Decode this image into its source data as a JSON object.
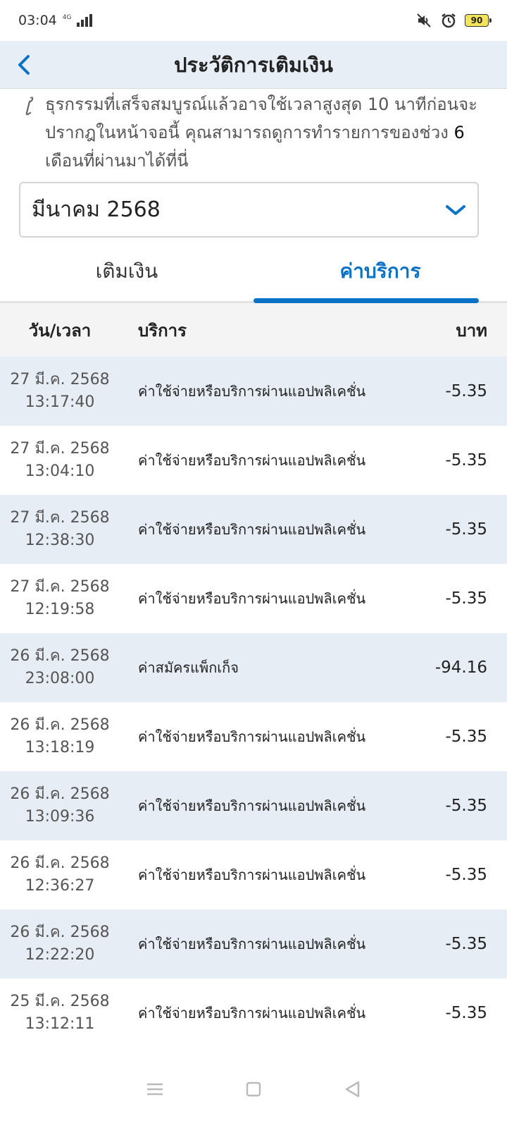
{
  "status_bar": {
    "time": "03:04",
    "network": "4G",
    "battery": "90"
  },
  "app_bar": {
    "title": "ประวัติการเติมเงิน"
  },
  "notice": {
    "text_a": "ธุรกรรมที่เสร็จสมบูรณ์แล้วอาจใช้เวลาสูงสุด 10 นาทีก่อนจะปรากฎในหน้าจอนี้ คุณสามารถดูการทำรายการของช่วง ",
    "highlight": "6",
    "text_b": " เดือนที่ผ่านมาได้ที่นี่"
  },
  "month_select": {
    "value": "มีนาคม 2568"
  },
  "tabs": [
    {
      "label": "เติมเงิน",
      "active": false
    },
    {
      "label": "ค่าบริการ",
      "active": true
    }
  ],
  "table": {
    "headers": {
      "date": "วัน/เวลา",
      "service": "บริการ",
      "amount": "บาท"
    },
    "rows": [
      {
        "date": "27 มี.ค. 2568",
        "time": "13:17:40",
        "service": "ค่าใช้จ่ายหรือบริการผ่านแอปพลิเคชั่น",
        "amount": "-5.35"
      },
      {
        "date": "27 มี.ค. 2568",
        "time": "13:04:10",
        "service": "ค่าใช้จ่ายหรือบริการผ่านแอปพลิเคชั่น",
        "amount": "-5.35"
      },
      {
        "date": "27 มี.ค. 2568",
        "time": "12:38:30",
        "service": "ค่าใช้จ่ายหรือบริการผ่านแอปพลิเคชั่น",
        "amount": "-5.35"
      },
      {
        "date": "27 มี.ค. 2568",
        "time": "12:19:58",
        "service": "ค่าใช้จ่ายหรือบริการผ่านแอปพลิเคชั่น",
        "amount": "-5.35"
      },
      {
        "date": "26 มี.ค. 2568",
        "time": "23:08:00",
        "service": "ค่าสมัครแพ็กเก็จ",
        "amount": "-94.16"
      },
      {
        "date": "26 มี.ค. 2568",
        "time": "13:18:19",
        "service": "ค่าใช้จ่ายหรือบริการผ่านแอปพลิเคชั่น",
        "amount": "-5.35"
      },
      {
        "date": "26 มี.ค. 2568",
        "time": "13:09:36",
        "service": "ค่าใช้จ่ายหรือบริการผ่านแอปพลิเคชั่น",
        "amount": "-5.35"
      },
      {
        "date": "26 มี.ค. 2568",
        "time": "12:36:27",
        "service": "ค่าใช้จ่ายหรือบริการผ่านแอปพลิเคชั่น",
        "amount": "-5.35"
      },
      {
        "date": "26 มี.ค. 2568",
        "time": "12:22:20",
        "service": "ค่าใช้จ่ายหรือบริการผ่านแอปพลิเคชั่น",
        "amount": "-5.35"
      },
      {
        "date": "25 มี.ค. 2568",
        "time": "13:12:11",
        "service": "ค่าใช้จ่ายหรือบริการผ่านแอปพลิเคชั่น",
        "amount": "-5.35"
      }
    ]
  },
  "icons": {
    "back": "chevron-left-icon",
    "dropdown": "chevron-down-icon",
    "info": "info-icon",
    "mute": "mute-icon",
    "alarm": "alarm-icon",
    "nav_menu": "menu-icon",
    "nav_home": "home-icon",
    "nav_back": "back-triangle-icon"
  },
  "colors": {
    "accent": "#0a73c8",
    "appbar_bg": "#e8eef5",
    "row_alt_bg": "#e7edf4",
    "header_bg": "#f4f4f4"
  }
}
